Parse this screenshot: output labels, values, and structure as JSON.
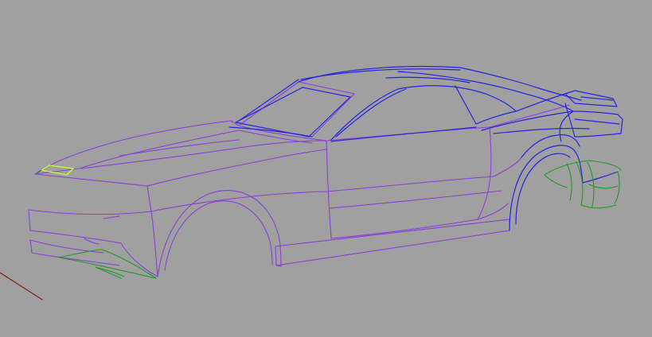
{
  "viewport": {
    "background": "#a0a0a0",
    "colors": {
      "body_curves": "#8a3fd6",
      "upper_curves": "#2424e0",
      "trim_curves": "#1f9a1f",
      "highlight_curve": "#c8ff3a",
      "axis": "#8a1a1a"
    }
  }
}
